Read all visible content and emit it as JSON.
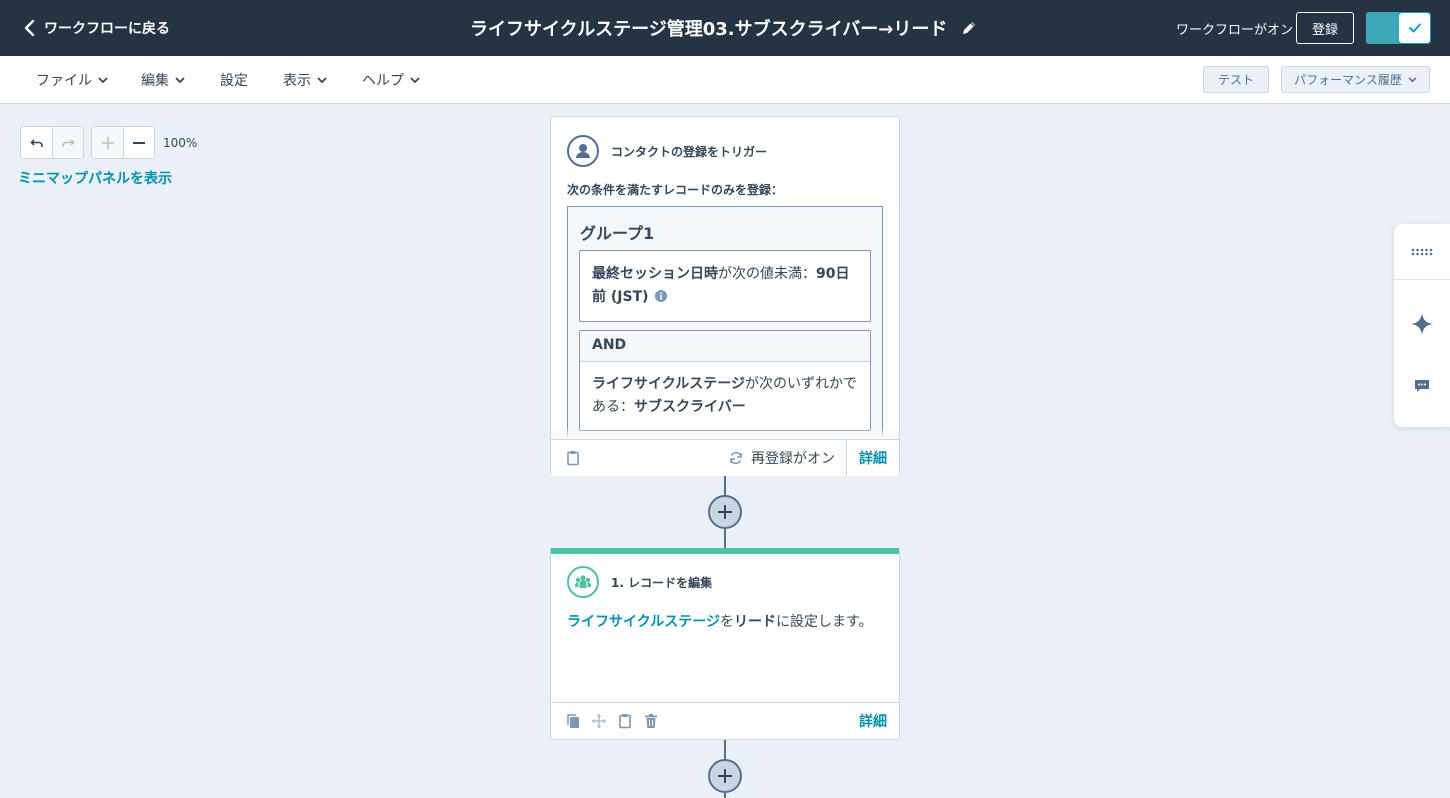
{
  "header": {
    "back_label": "ワークフローに戻る",
    "workflow_title": "ライフサイクルステージ管理03.サブスクライバー→リード",
    "status_text": "ワークフローがオン",
    "register_label": "登録",
    "toggle_on": true
  },
  "menubar": {
    "file": "ファイル",
    "edit": "編集",
    "settings": "設定",
    "view": "表示",
    "help": "ヘルプ",
    "test_label": "テスト",
    "performance_label": "パフォーマンス履歴"
  },
  "canvas": {
    "zoom_level": "100%",
    "minimap_link": "ミニマップパネルを表示"
  },
  "trigger_card": {
    "title": "コンタクトの登録をトリガー",
    "condition_label": "次の条件を満たすレコードのみを登録：",
    "group_title": "グループ1",
    "filter1_property": "最終セッション日時",
    "filter1_operator": "が次の値未満：",
    "filter1_value": "90日前 (JST)",
    "and_label": "AND",
    "filter2_property": "ライフサイクルステージ",
    "filter2_operator": "が次のいずれかである：",
    "filter2_value": "サブスクライバー",
    "reenroll_label": "再登録がオン",
    "detail_label": "詳細"
  },
  "action_card": {
    "title": "1. レコードを編集",
    "property_link": "ライフサイクルステージ",
    "connector1": "を",
    "value": "リード",
    "connector2": "に設定します。",
    "detail_label": "詳細"
  },
  "colors": {
    "header_bg": "#253342",
    "canvas_bg": "#eaf0f6",
    "link": "#0091ae",
    "action_accent": "#4fc1a6",
    "toggle": "#00a4bd"
  },
  "icons": [
    "chevron-left-icon",
    "pencil-icon",
    "check-icon",
    "chevron-down-icon",
    "undo-icon",
    "redo-icon",
    "zoom-in-icon",
    "zoom-out-icon",
    "contact-icon",
    "info-icon",
    "clipboard-icon",
    "refresh-icon",
    "plus-icon",
    "team-icon",
    "copy-icon",
    "move-icon",
    "trash-icon",
    "grid-dots-icon",
    "sparkle-icon",
    "chat-icon"
  ]
}
